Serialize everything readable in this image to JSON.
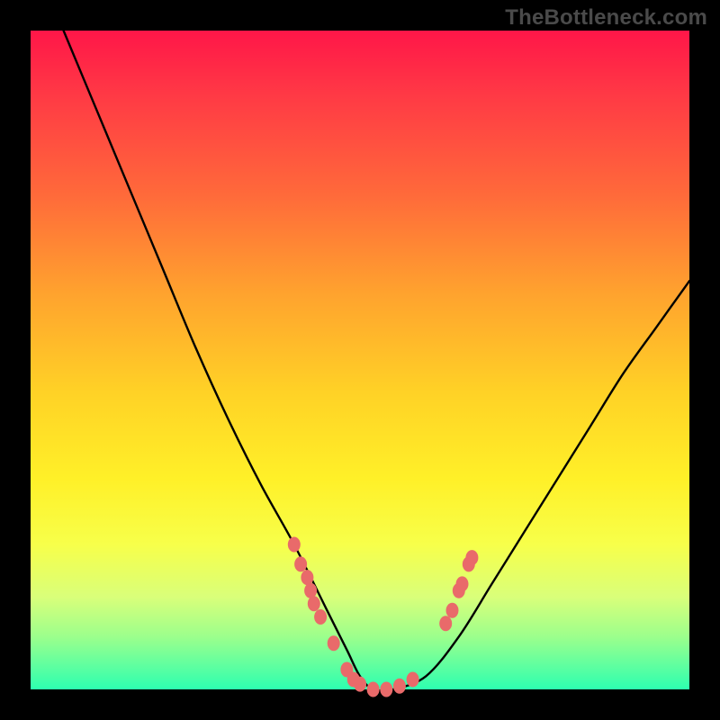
{
  "watermark": "TheBottleneck.com",
  "chart_data": {
    "type": "line",
    "title": "",
    "xlabel": "",
    "ylabel": "",
    "xlim": [
      0,
      100
    ],
    "ylim": [
      0,
      100
    ],
    "grid": false,
    "legend": false,
    "background_gradient": {
      "orientation": "vertical",
      "stops": [
        {
          "pos": 0,
          "color": "#ff1648"
        },
        {
          "pos": 25,
          "color": "#ff6a3a"
        },
        {
          "pos": 55,
          "color": "#ffd226"
        },
        {
          "pos": 78,
          "color": "#f7ff4a"
        },
        {
          "pos": 100,
          "color": "#2dffb0"
        }
      ]
    },
    "series": [
      {
        "name": "bottleneck-curve",
        "x": [
          5,
          10,
          15,
          20,
          25,
          30,
          35,
          40,
          45,
          48,
          50,
          52,
          55,
          60,
          65,
          70,
          75,
          80,
          85,
          90,
          95,
          100
        ],
        "y": [
          100,
          88,
          76,
          64,
          52,
          41,
          31,
          22,
          12,
          6,
          2,
          0,
          0,
          2,
          8,
          16,
          24,
          32,
          40,
          48,
          55,
          62
        ]
      }
    ],
    "markers": {
      "name": "highlighted-points",
      "color": "#e96a6a",
      "points": [
        {
          "x": 40,
          "y": 22
        },
        {
          "x": 41,
          "y": 19
        },
        {
          "x": 42,
          "y": 17
        },
        {
          "x": 42.5,
          "y": 15
        },
        {
          "x": 43,
          "y": 13
        },
        {
          "x": 44,
          "y": 11
        },
        {
          "x": 46,
          "y": 7
        },
        {
          "x": 48,
          "y": 3
        },
        {
          "x": 49,
          "y": 1.5
        },
        {
          "x": 50,
          "y": 0.8
        },
        {
          "x": 52,
          "y": 0
        },
        {
          "x": 54,
          "y": 0
        },
        {
          "x": 56,
          "y": 0.5
        },
        {
          "x": 58,
          "y": 1.5
        },
        {
          "x": 63,
          "y": 10
        },
        {
          "x": 64,
          "y": 12
        },
        {
          "x": 65,
          "y": 15
        },
        {
          "x": 65.5,
          "y": 16
        },
        {
          "x": 66.5,
          "y": 19
        },
        {
          "x": 67,
          "y": 20
        }
      ]
    }
  }
}
